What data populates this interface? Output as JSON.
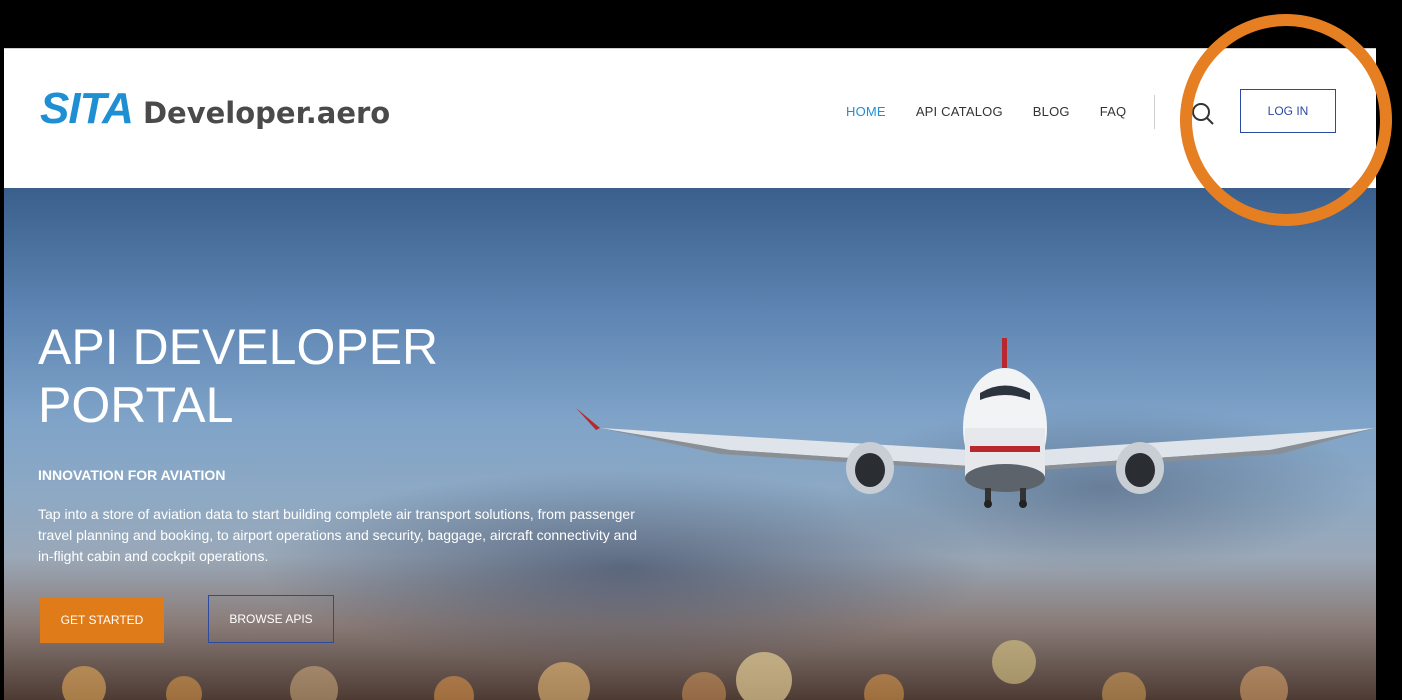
{
  "header": {
    "logo_brand": "SITA",
    "logo_site": "Developer.aero",
    "nav": {
      "home": "HOME",
      "api_catalog": "API CATALOG",
      "blog": "BLOG",
      "faq": "FAQ"
    },
    "search_icon": "search-icon",
    "login_label": "LOG IN"
  },
  "hero": {
    "title_line1": "API DEVELOPER",
    "title_line2": "PORTAL",
    "subtitle": "INNOVATION FOR AVIATION",
    "description": "Tap into a store of aviation data to start building complete air transport solutions, from passenger travel planning and booking, to airport operations and security, baggage, aircraft connectivity and in-flight cabin and cockpit operations.",
    "get_started_label": "GET STARTED",
    "browse_apis_label": "BROWSE APIS"
  },
  "colors": {
    "brand_blue": "#1f8fd4",
    "nav_active": "#1f8fd4",
    "login_border": "#2b4aa0",
    "cta_orange": "#e07b1a",
    "highlight_circle": "#e67e22"
  }
}
